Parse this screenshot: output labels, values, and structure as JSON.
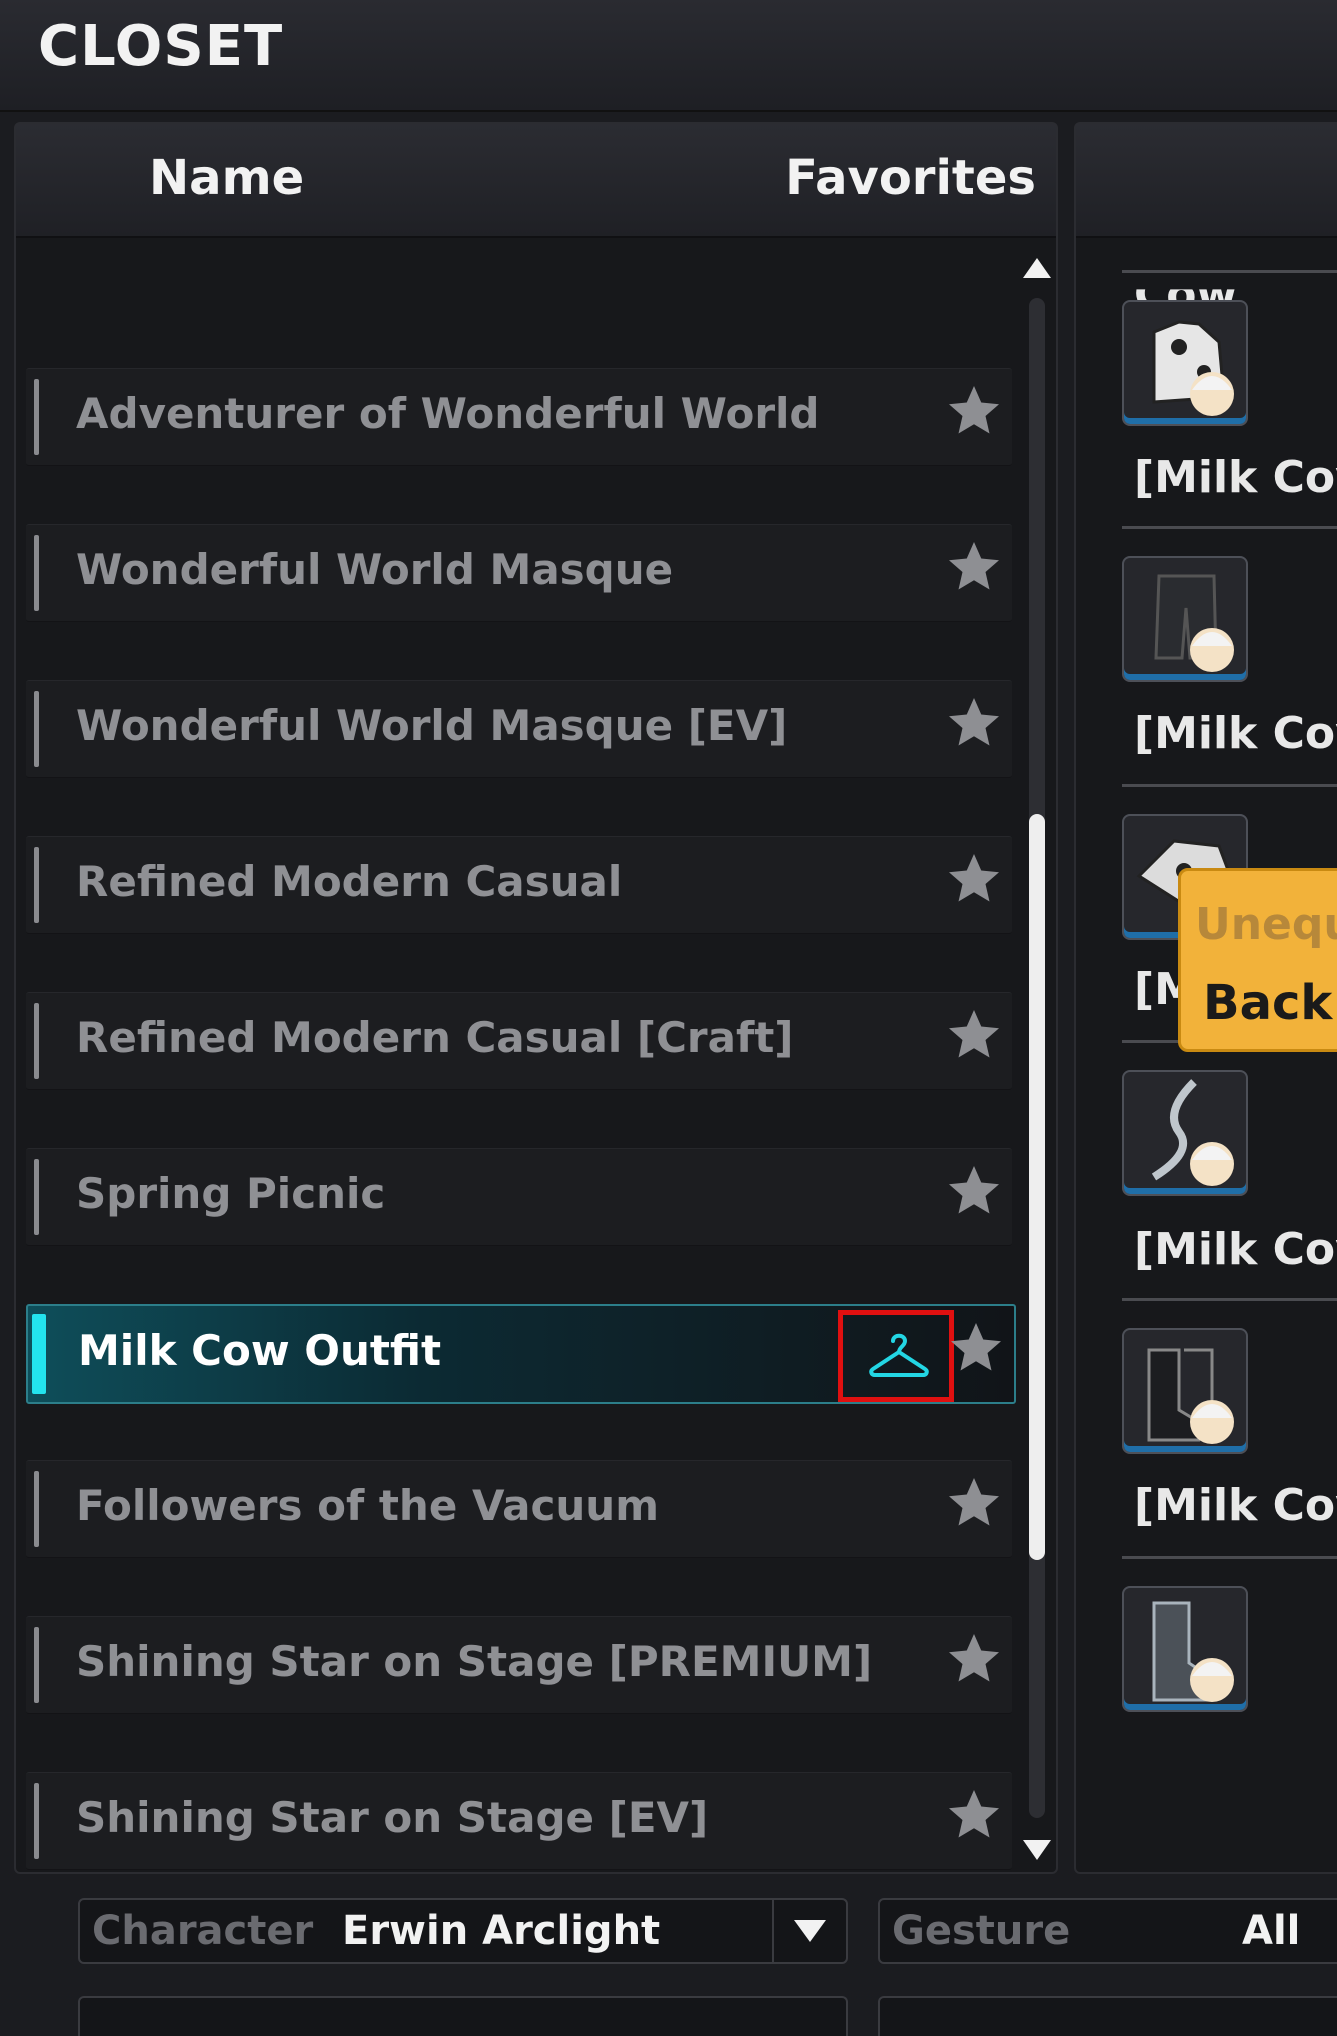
{
  "window": {
    "title": "CLOSET"
  },
  "list": {
    "headers": {
      "name": "Name",
      "favorites": "Favorites"
    },
    "items": [
      {
        "label": "Adventurer of Wonderful World",
        "selected": false
      },
      {
        "label": "Wonderful World Masque",
        "selected": false
      },
      {
        "label": "Wonderful World Masque [EV]",
        "selected": false
      },
      {
        "label": "Refined Modern Casual",
        "selected": false
      },
      {
        "label": "Refined Modern Casual [Craft]",
        "selected": false
      },
      {
        "label": "Spring Picnic",
        "selected": false
      },
      {
        "label": "Milk Cow Outfit",
        "selected": true
      },
      {
        "label": "Followers of the Vacuum",
        "selected": false
      },
      {
        "label": "Shining Star on Stage [PREMIUM]",
        "selected": false
      },
      {
        "label": "Shining Star on Stage [EV]",
        "selected": false
      }
    ]
  },
  "items_panel": {
    "top_partial": "[Milk Cow",
    "entries": [
      "[Milk Cov",
      "[Milk Cov",
      "[M",
      "[Milk Cov",
      "[Milk Cov"
    ]
  },
  "tooltip": {
    "line1": "Unequ",
    "line2": "Back ("
  },
  "filters": {
    "character": {
      "label": "Character",
      "value": "Erwin Arclight"
    },
    "gesture": {
      "label": "Gesture",
      "value": "All"
    }
  },
  "icons": {
    "favorite": "star-icon",
    "wear": "hanger-icon",
    "dropdown": "chevron-down-icon"
  },
  "colors": {
    "accent": "#23e3ee",
    "highlight_box": "#e01010",
    "tooltip_bg": "#f2b23a"
  }
}
